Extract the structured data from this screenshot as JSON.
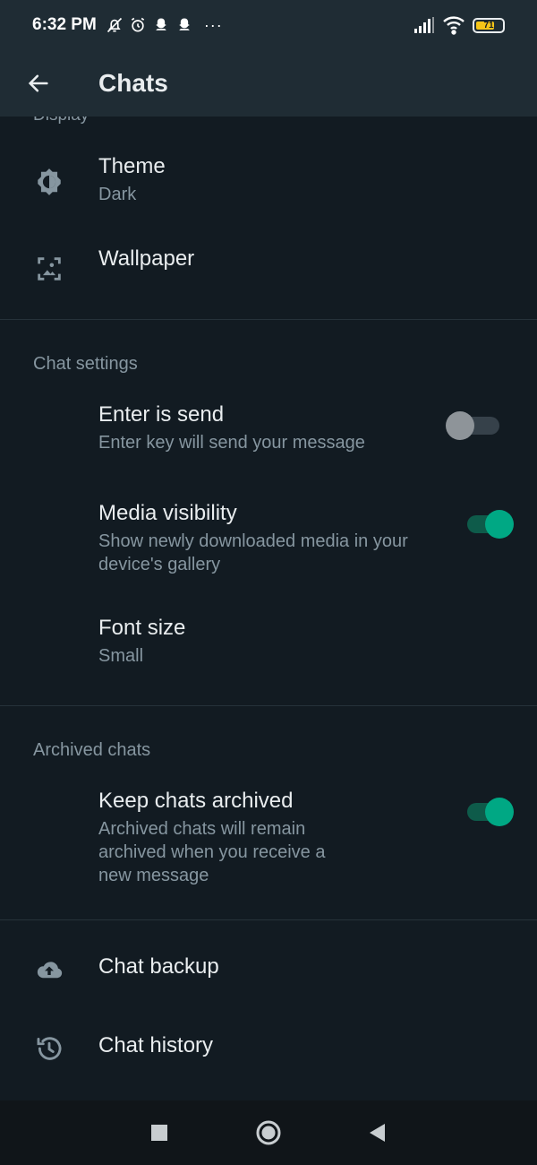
{
  "status_bar": {
    "time": "6:32 PM",
    "battery_text": "71",
    "battery_level": 0.71,
    "icons_left": [
      "bell-off-icon",
      "alarm-icon",
      "snapchat-icon",
      "snapchat-icon",
      "more-dots-icon"
    ],
    "more_dots": "···",
    "icons_right": [
      "signal-icon",
      "wifi-icon",
      "battery-icon"
    ]
  },
  "app_bar": {
    "title": "Chats",
    "back_icon": "arrow-left-icon"
  },
  "display_section": {
    "header": "Display",
    "theme": {
      "title": "Theme",
      "value": "Dark",
      "icon": "brightness-icon"
    },
    "wallpaper": {
      "title": "Wallpaper",
      "icon": "wallpaper-icon"
    }
  },
  "chat_settings": {
    "header": "Chat settings",
    "enter_is_send": {
      "title": "Enter is send",
      "subtitle": "Enter key will send your message",
      "enabled": false
    },
    "media_visibility": {
      "title": "Media visibility",
      "subtitle": "Show newly downloaded media in your device's gallery",
      "enabled": true
    },
    "font_size": {
      "title": "Font size",
      "value": "Small"
    }
  },
  "archived_chats": {
    "header": "Archived chats",
    "keep_archived": {
      "title": "Keep chats archived",
      "subtitle": "Archived chats will remain archived when you receive a new message",
      "enabled": true
    }
  },
  "bottom_items": {
    "chat_backup": {
      "title": "Chat backup",
      "icon": "cloud-upload-icon"
    },
    "chat_history": {
      "title": "Chat history",
      "icon": "history-icon"
    }
  },
  "nav_bar": {
    "buttons": [
      "recents-square-icon",
      "home-circle-icon",
      "back-triangle-icon"
    ]
  },
  "colors": {
    "background": "#121b22",
    "app_bar": "#1f2c34",
    "accent_green": "#00a884",
    "toggle_off_knob": "#8e9499",
    "primary_text": "#e9edef",
    "secondary_text": "#8696a0"
  }
}
